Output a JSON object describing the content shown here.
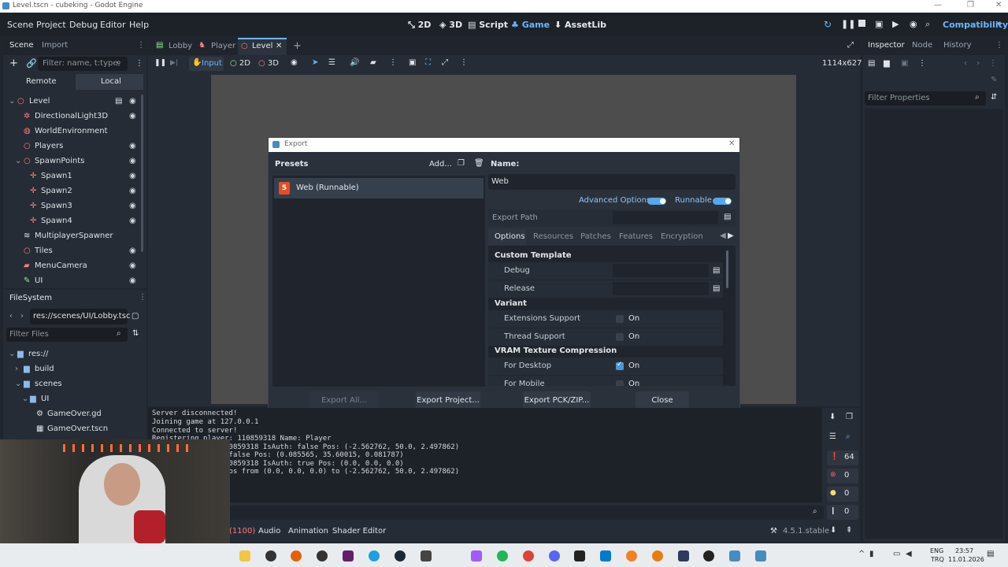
{
  "window": {
    "title": "Level.tscn - cubeking - Godot Engine"
  },
  "menu": [
    "Scene",
    "Project",
    "Debug",
    "Editor",
    "Help"
  ],
  "modes": [
    "2D",
    "3D",
    "Script",
    "Game",
    "AssetLib"
  ],
  "renderer": "Compatibility",
  "scene_dock": {
    "tabs": [
      "Scene",
      "Import"
    ],
    "filter_placeholder": "Filter: name, t:type,",
    "remote": "Remote",
    "local": "Local",
    "tree": [
      "Level",
      "DirectionalLight3D",
      "WorldEnvironment",
      "Players",
      "SpawnPoints",
      "Spawn1",
      "Spawn2",
      "Spawn3",
      "Spawn4",
      "MultiplayerSpawner",
      "Tiles",
      "MenuCamera",
      "UI"
    ]
  },
  "filesystem": {
    "title": "FileSystem",
    "path": "res://scenes/UI/Lobby.tsc",
    "filter_placeholder": "Filter Files",
    "items": [
      "res://",
      "build",
      "scenes",
      "UI",
      "GameOver.gd",
      "GameOver.tscn"
    ]
  },
  "editor_tabs": [
    "Lobby",
    "Player",
    "Level"
  ],
  "game_toolbar": {
    "input": "Input",
    "mode2d": "2D",
    "mode3d": "3D",
    "resolution": "1114x627"
  },
  "inspector": {
    "tabs": [
      "Inspector",
      "Node",
      "History"
    ],
    "filter_placeholder": "Filter Properties"
  },
  "export_dialog": {
    "title": "Export",
    "presets_label": "Presets",
    "add": "Add...",
    "preset": "Web (Runnable)",
    "name_label": "Name:",
    "name_value": "Web",
    "advanced_options": "Advanced Options",
    "runnable": "Runnable",
    "export_path": "Export Path",
    "tabs": [
      "Options",
      "Resources",
      "Patches",
      "Features",
      "Encryption"
    ],
    "custom_template": "Custom Template",
    "debug": "Debug",
    "release": "Release",
    "variant": "Variant",
    "extensions_support": "Extensions Support",
    "thread_support": "Thread Support",
    "vram": "VRAM Texture Compression",
    "for_desktop": "For Desktop",
    "for_mobile": "For Mobile",
    "on": "On",
    "buttons": {
      "export_all": "Export All...",
      "export_project": "Export Project...",
      "export_pck": "Export PCK/ZIP...",
      "close": "Close"
    }
  },
  "console": [
    "Server disconnected!",
    "Joining game at 127.0.0.1",
    "Connected to server!",
    "Registering player: 110859318 Name: Player",
    "     9318 Auth: 110859318 IsAuth: false Pos: (-2.562762, 50.0, 2.497862)",
    "     h: 1 IsAuth: false Pos: (0.085565, 35.60015, 0.081787)",
    "     9318 Auth: 110859318 IsAuth: true Pos: (0.0, 0.0, 0.0)",
    "     te! Setting pos from (0.0, 0.0, 0.0) to (-2.562762, 50.0, 2.497862)"
  ],
  "console_counts": {
    "messages": "64",
    "errors": "0",
    "warnings": "0",
    "info": "0"
  },
  "bottom_tabs": [
    "(1100)",
    "Audio",
    "Animation",
    "Shader Editor"
  ],
  "version": "4.5.1.stable",
  "tray": {
    "lang": "ENG",
    "region": "TRQ",
    "time": "23:57",
    "date": "11.01.2026"
  }
}
